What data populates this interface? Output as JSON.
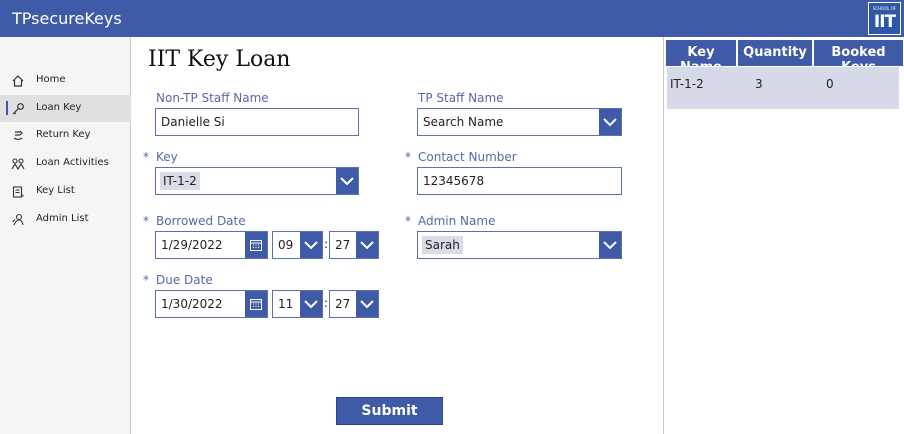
{
  "app": {
    "title": "TPsecureKeys",
    "logo_small": "SCHOOL OF",
    "logo_big": "IIT"
  },
  "sidebar": {
    "items": [
      {
        "label": "Home",
        "icon": "home-icon"
      },
      {
        "label": "Loan Key",
        "icon": "key-icon",
        "active": true
      },
      {
        "label": "Return Key",
        "icon": "return-key-icon"
      },
      {
        "label": "Loan Activities",
        "icon": "activities-icon"
      },
      {
        "label": "Key List",
        "icon": "list-icon"
      },
      {
        "label": "Admin List",
        "icon": "admin-icon"
      }
    ]
  },
  "form": {
    "title": "IIT Key Loan",
    "nontp_label": "Non-TP Staff Name",
    "nontp_value": "Danielle Si",
    "tp_label": "TP Staff Name",
    "tp_placeholder": "Search Name",
    "key_label": "Key",
    "key_value": "IT-1-2",
    "contact_label": "Contact Number",
    "contact_value": "12345678",
    "borrowed_label": "Borrowed Date",
    "borrowed_date": "1/29/2022",
    "borrowed_hour": "09",
    "borrowed_minute": "27",
    "admin_label": "Admin Name",
    "admin_value": "Sarah",
    "due_label": "Due Date",
    "due_date": "1/30/2022",
    "due_hour": "11",
    "due_minute": "27",
    "colon": ":",
    "required_mark": "*",
    "submit_label": "Submit"
  },
  "keys_table": {
    "headers": [
      "Key Name",
      "Quantity",
      "Booked Keys"
    ],
    "rows": [
      [
        "IT-1-2",
        "3",
        "0"
      ]
    ]
  },
  "colors": {
    "accent": "#3f5ba8",
    "label": "#5868a8",
    "row_bg": "#d5d9e8"
  }
}
